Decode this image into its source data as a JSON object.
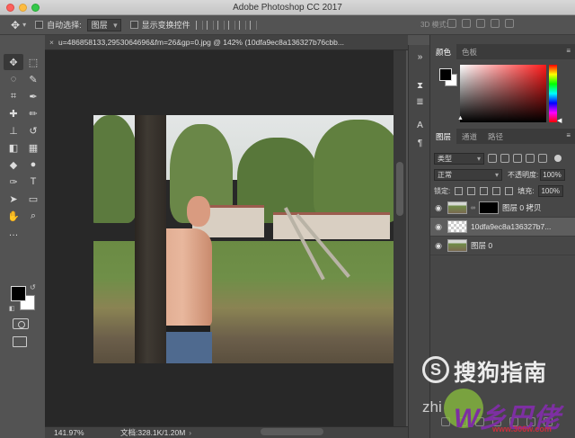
{
  "app": {
    "title": "Adobe Photoshop CC 2017"
  },
  "options": {
    "auto_select_label": "自动选择:",
    "auto_select_target": "图层",
    "show_transform_label": "显示变换控件",
    "mode_3d_label": "3D 模式:"
  },
  "document": {
    "tab_title": "u=486858133,2953064696&fm=26&gp=0.jpg @ 142% (10dfa9ec8a136327b76cbb...",
    "close_glyph": "×"
  },
  "status": {
    "zoom": "141.97%",
    "doc_size": "文档:328.1K/1.20M",
    "caret": "›"
  },
  "tools": [
    {
      "name": "move-tool",
      "glyph": "✥"
    },
    {
      "name": "marquee-tool",
      "glyph": "⬚"
    },
    {
      "name": "lasso-tool",
      "glyph": "◌"
    },
    {
      "name": "quick-select-tool",
      "glyph": "✎"
    },
    {
      "name": "crop-tool",
      "glyph": "⌗"
    },
    {
      "name": "eyedropper-tool",
      "glyph": "✒"
    },
    {
      "name": "healing-tool",
      "glyph": "✚"
    },
    {
      "name": "brush-tool",
      "glyph": "✏"
    },
    {
      "name": "stamp-tool",
      "glyph": "⊥"
    },
    {
      "name": "history-brush-tool",
      "glyph": "↺"
    },
    {
      "name": "eraser-tool",
      "glyph": "◧"
    },
    {
      "name": "gradient-tool",
      "glyph": "▦"
    },
    {
      "name": "blur-tool",
      "glyph": "◆"
    },
    {
      "name": "dodge-tool",
      "glyph": "●"
    },
    {
      "name": "pen-tool",
      "glyph": "✑"
    },
    {
      "name": "type-tool",
      "glyph": "T"
    },
    {
      "name": "path-select-tool",
      "glyph": "➤"
    },
    {
      "name": "shape-tool",
      "glyph": "▭"
    },
    {
      "name": "hand-tool",
      "glyph": "✋"
    },
    {
      "name": "zoom-tool",
      "glyph": "⌕"
    },
    {
      "name": "more-tools",
      "glyph": "…"
    },
    {
      "name": "blank-tool",
      "glyph": ""
    }
  ],
  "panels": {
    "color_tab": "颜色",
    "swatches_tab": "色板",
    "layers_tab": "图层",
    "channels_tab": "通道",
    "paths_tab": "路径",
    "filter_kind": "类型",
    "blend_mode": "正常",
    "opacity_label": "不透明度:",
    "opacity_value": "100%",
    "lock_label": "锁定:",
    "fill_label": "填充:",
    "fill_value": "100%",
    "menu_glyph": "≡"
  },
  "layers": [
    {
      "name": "图层 0 拷贝",
      "type": "photo-mask",
      "selected": false
    },
    {
      "name": "10dfa9ec8a136327b7...",
      "type": "transparent",
      "selected": true
    },
    {
      "name": "图层 0",
      "type": "photo",
      "selected": false
    }
  ],
  "watermark": {
    "brand": "搜狗指南",
    "zhi": "zhi",
    "site": "www.306w.com",
    "logo_text": "W乡巴佬"
  },
  "colors": {
    "accent": "#535353",
    "selected_layer": "#5e5e5e"
  }
}
